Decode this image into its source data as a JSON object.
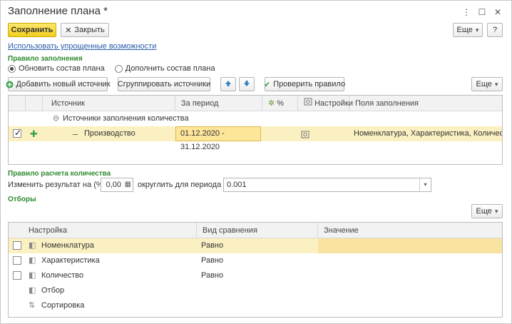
{
  "window": {
    "title": "Заполнение плана *",
    "controls": [
      "more-icon",
      "restore-icon",
      "close-icon"
    ]
  },
  "toolbar": {
    "save_label": "Сохранить",
    "close_label": "Закрыть",
    "more_label": "Еще",
    "help_label": "?"
  },
  "simplified_link": "Использовать упрощенные возможности",
  "fill_rule": {
    "section_title": "Правило заполнения",
    "options": [
      "Обновить состав плана",
      "Дополнить состав плана"
    ],
    "selected": 0
  },
  "sources_toolbar": {
    "add_label": "Добавить новый источник",
    "group_label": "Сгруппировать источники",
    "check_label": "Проверить правило",
    "more_label": "Еще"
  },
  "sources_table": {
    "columns": [
      "Источник",
      "За период",
      "%",
      "Настройки",
      "Поля заполнения"
    ],
    "group_row": "Источники заполнения количества",
    "row": {
      "checked": true,
      "source": "Производство",
      "period": "01.12.2020 - 31.12.2020",
      "fields": "Номенклатура, Характеристика, Количество"
    }
  },
  "quantity_rule": {
    "section_title": "Правило расчета количества",
    "change_label": "Изменить результат на (%):",
    "change_value": "0,00",
    "round_label": "округлить для периода до:",
    "round_value": "0.001"
  },
  "filters": {
    "section_title": "Отборы",
    "more_label": "Еще",
    "columns": [
      "Настройка",
      "Вид сравнения",
      "Значение"
    ],
    "rows": [
      {
        "name": "Номенклатура",
        "comparison": "Равно",
        "value": "",
        "checkbox": true
      },
      {
        "name": "Характеристика",
        "comparison": "Равно",
        "value": "",
        "checkbox": true
      },
      {
        "name": "Количество",
        "comparison": "Равно",
        "value": "",
        "checkbox": true
      },
      {
        "name": "Отбор",
        "comparison": "",
        "value": "",
        "checkbox": false
      },
      {
        "name": "Сортировка",
        "comparison": "",
        "value": "",
        "checkbox": false
      }
    ]
  },
  "colors": {
    "save_button": "#f2cf1f",
    "section_title": "#2e8a2e",
    "link": "#2a5caa",
    "selected_row": "#fbf0c2"
  }
}
